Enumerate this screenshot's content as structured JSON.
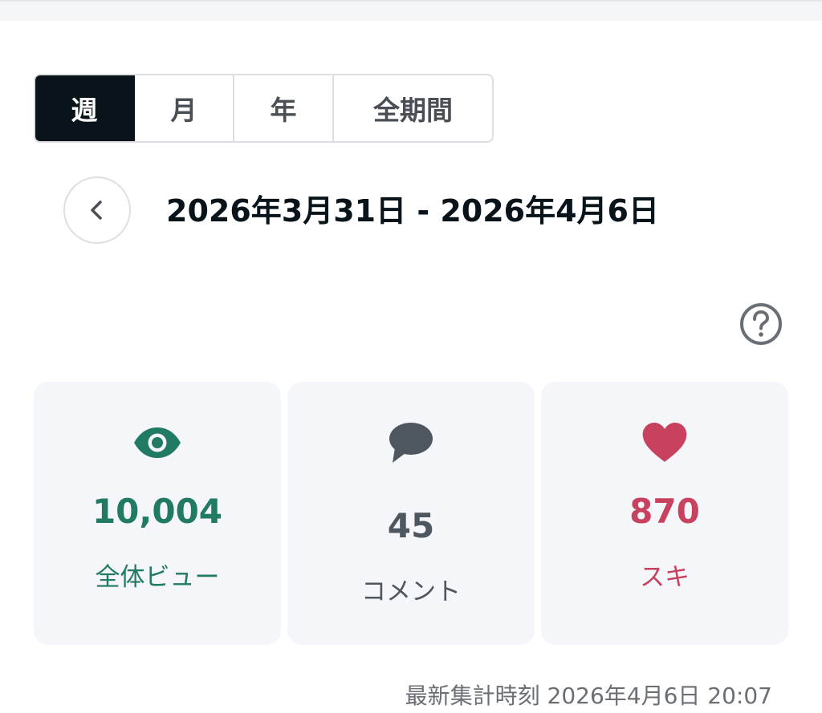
{
  "period_tabs": [
    {
      "label": "週",
      "active": true
    },
    {
      "label": "月",
      "active": false
    },
    {
      "label": "年",
      "active": false
    },
    {
      "label": "全期間",
      "active": false
    }
  ],
  "date_range": "2026年3月31日 - 2026年4月6日",
  "stats": {
    "views": {
      "value": "10,004",
      "label": "全体ビュー",
      "icon": "eye-icon",
      "color": "#217a63"
    },
    "comments": {
      "value": "45",
      "label": "コメント",
      "icon": "comment-icon",
      "color": "#4e5660"
    },
    "likes": {
      "value": "870",
      "label": "スキ",
      "icon": "heart-icon",
      "color": "#c8415e"
    }
  },
  "updated_at": "最新集計時刻 2026年4月6日 20:07",
  "colors": {
    "active_tab_bg": "#08131a",
    "card_bg": "#f4f6f9"
  }
}
